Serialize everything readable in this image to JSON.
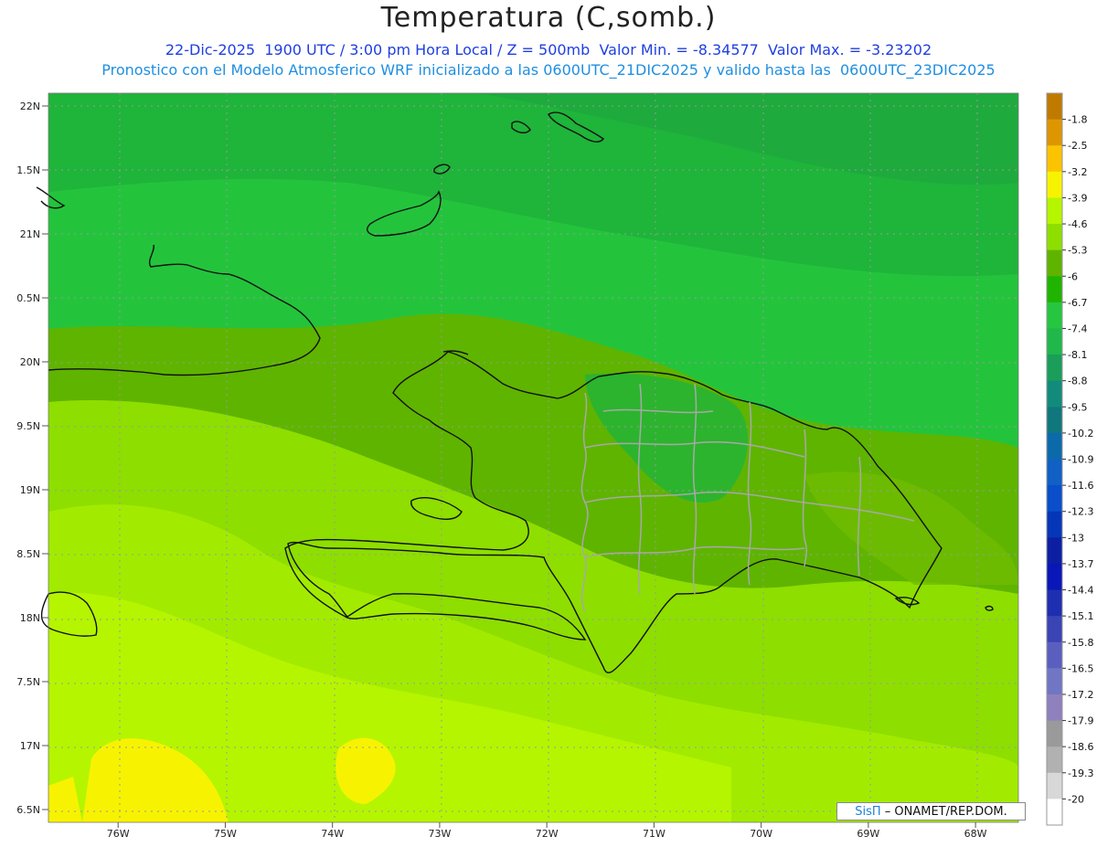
{
  "title": "Temperatura (C,somb.)",
  "subtitle_line1": "22-Dic-2025  1900 UTC / 3:00 pm Hora Local / Z = 500mb  Valor Min. = -8.34577  Valor Max. = -3.23202",
  "subtitle_line2": "Pronostico con el Modelo Atmosferico WRF inicializado a las 0600UTC_21DIC2025 y valido hasta las  0600UTC_23DIC2025",
  "credit": {
    "brand": "SisΠ",
    "text": "– ONAMET/REP.DOM."
  },
  "chart_data": {
    "type": "heatmap",
    "title": "Temperatura (C,somb.)",
    "x_ticks": [
      "76W",
      "75W",
      "74W",
      "73W",
      "72W",
      "71W",
      "70W",
      "69W",
      "68W"
    ],
    "x_values": [
      -76,
      -75,
      -74,
      -73,
      -72,
      -71,
      -70,
      -69,
      -68
    ],
    "y_ticks": [
      "22N",
      "1.5N",
      "21N",
      "0.5N",
      "20N",
      "9.5N",
      "19N",
      "8.5N",
      "18N",
      "7.5N",
      "17N",
      "6.5N"
    ],
    "y_values": [
      22,
      21.5,
      21,
      20.5,
      20,
      19.5,
      19,
      18.5,
      18,
      17.5,
      17,
      16.5
    ],
    "xlim": [
      -76.65,
      -67.6
    ],
    "ylim": [
      16.4,
      22.1
    ],
    "grid": true,
    "colorbar": {
      "labels": [
        "-1.8",
        "-2.5",
        "-3.2",
        "-3.9",
        "-4.6",
        "-5.3",
        "-6",
        "-6.7",
        "-7.4",
        "-8.1",
        "-8.8",
        "-9.5",
        "-10.2",
        "-10.9",
        "-11.6",
        "-12.3",
        "-13",
        "-13.7",
        "-14.4",
        "-15.1",
        "-15.8",
        "-16.5",
        "-17.2",
        "-17.9",
        "-18.6",
        "-19.3",
        "-20"
      ],
      "colors": [
        "#c07a00",
        "#de9600",
        "#fbc300",
        "#f7f300",
        "#b5f500",
        "#8ede00",
        "#5fb400",
        "#1fb400",
        "#25c640",
        "#20b84a",
        "#1a9e5a",
        "#128b7c",
        "#10787d",
        "#0c6aaa",
        "#1060c5",
        "#0a4ecb",
        "#0636b8",
        "#0c1fa2",
        "#0a17b8",
        "#1d2eb0",
        "#3a44b5",
        "#5a5fbf",
        "#7076c4",
        "#8f80be",
        "#9a9a9a",
        "#b1b1b1",
        "#d8d8d8",
        "#ffffff"
      ]
    },
    "min_value": -8.34577,
    "max_value": -3.23202
  }
}
